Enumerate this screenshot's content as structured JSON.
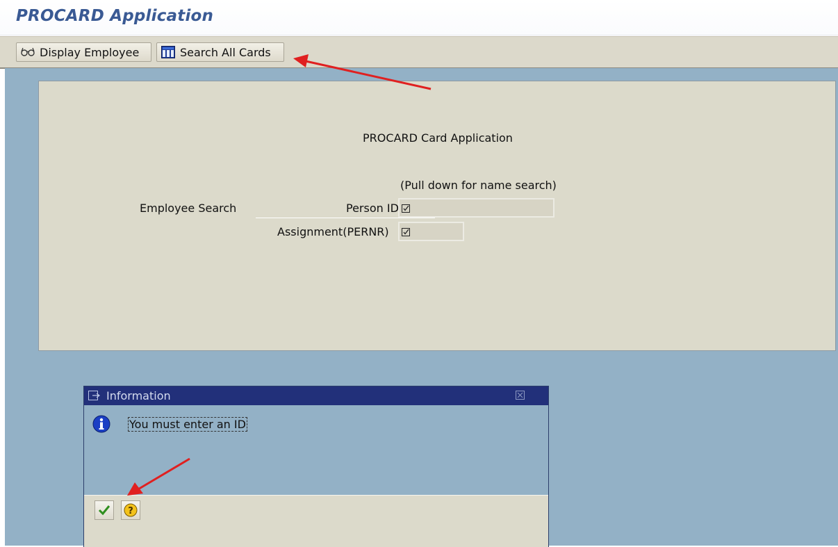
{
  "window": {
    "title": "PROCARD Application"
  },
  "toolbar": {
    "display_employee_label": "Display Employee",
    "display_employee_icon": "glasses-icon",
    "search_all_cards_label": "Search All Cards",
    "search_all_cards_icon": "grid-icon"
  },
  "form": {
    "title": "PROCARD Card Application",
    "hint": "(Pull down for name search)",
    "employee_search_label": "Employee Search",
    "person_id_label": "Person ID",
    "person_id_value": "",
    "assignment_label": "Assignment(PERNR)",
    "assignment_value": ""
  },
  "dialog": {
    "title": "Information",
    "message": "You must enter an ID",
    "icon": "info-icon",
    "buttons": [
      "confirm-checkmark",
      "help"
    ]
  },
  "colors": {
    "title_text": "#3a5a94",
    "panel_bg": "#dcdacb",
    "workarea_bg": "#93b1c6",
    "dialog_titlebar": "#22307a",
    "annotation_arrow": "#e02020"
  }
}
